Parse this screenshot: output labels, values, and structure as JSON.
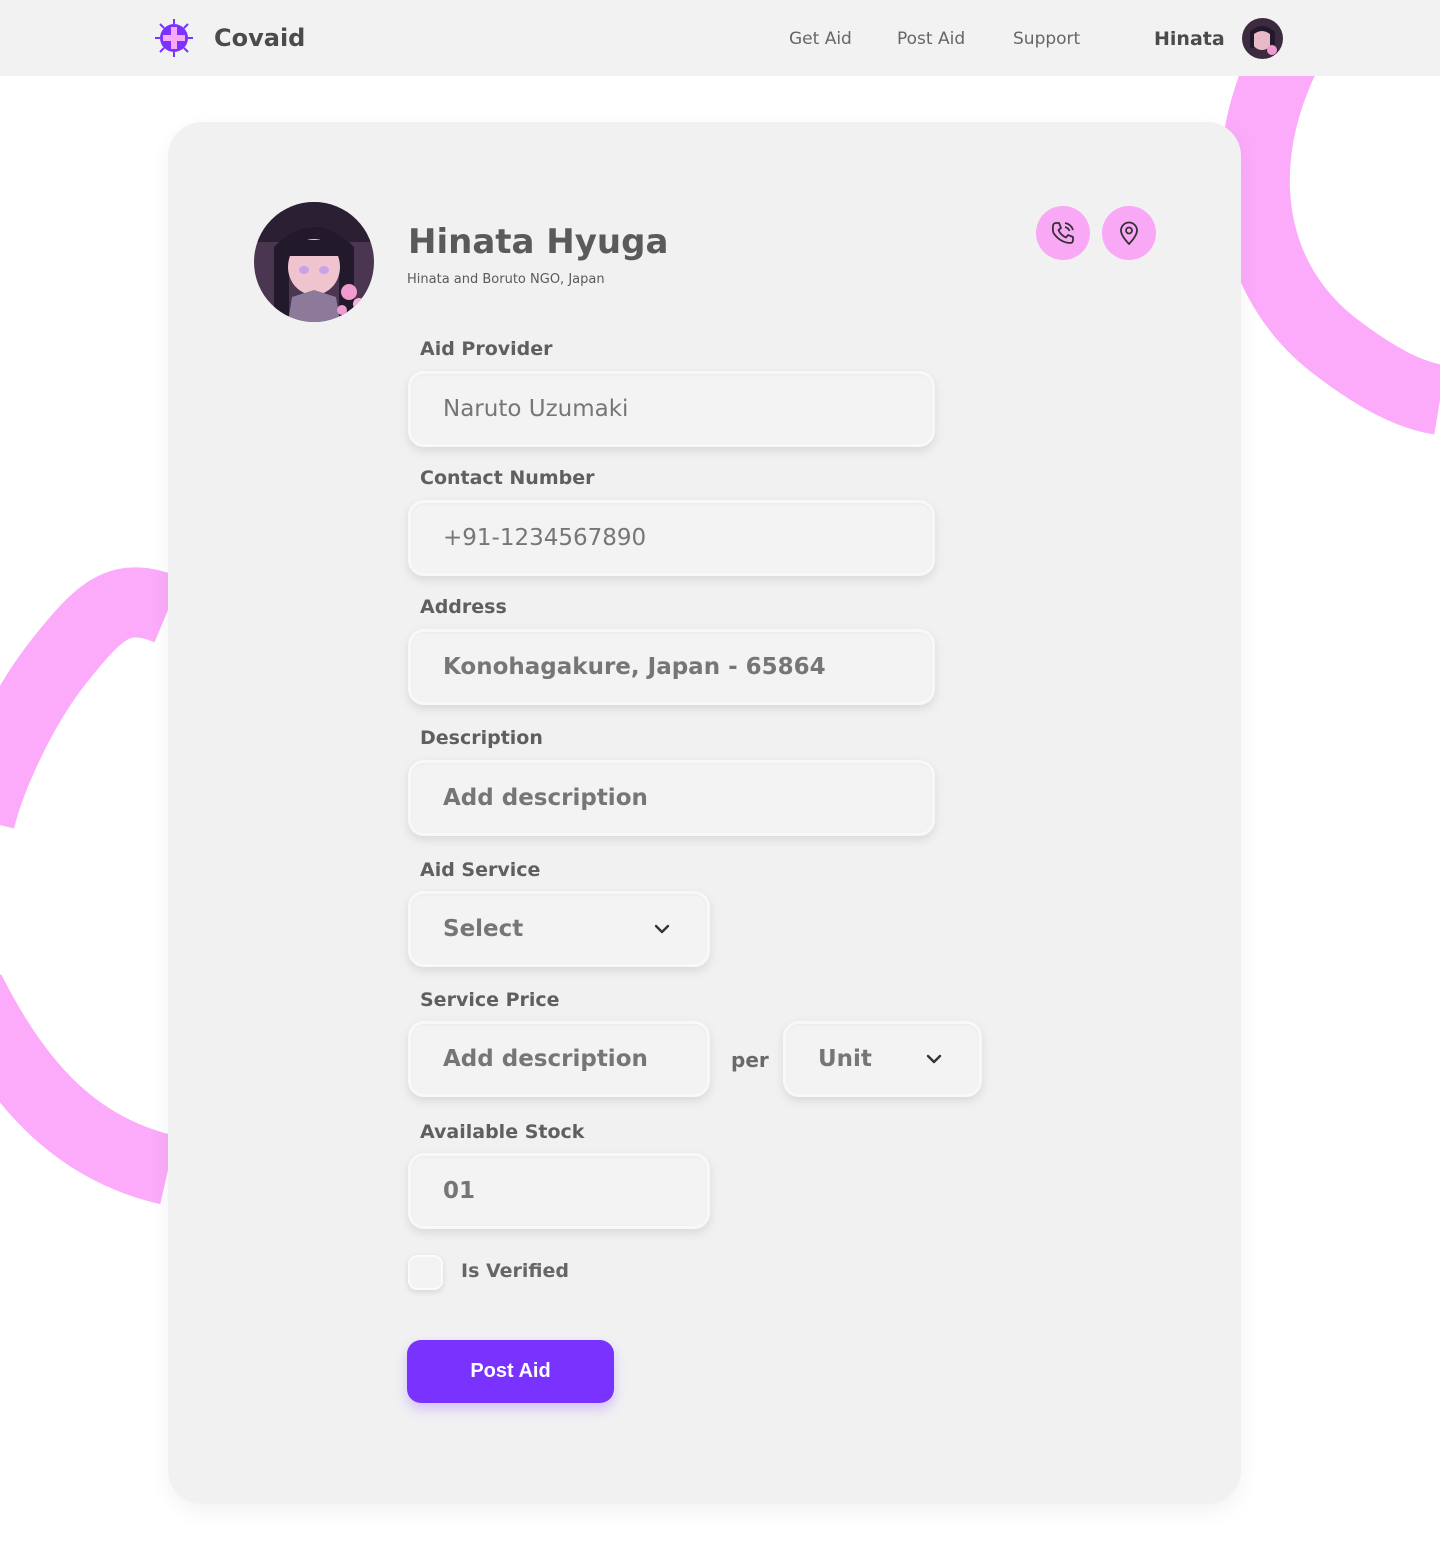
{
  "header": {
    "brand": "Covaid",
    "nav": [
      {
        "label": "Get Aid"
      },
      {
        "label": "Post Aid"
      },
      {
        "label": "Support"
      }
    ],
    "user_name": "Hinata"
  },
  "profile": {
    "name": "Hinata Hyuga",
    "organization": "Hinata and Boruto NGO, Japan",
    "actions": [
      "phone-icon",
      "location-pin-icon"
    ]
  },
  "form": {
    "aid_provider": {
      "label": "Aid Provider",
      "value": "Naruto Uzumaki"
    },
    "contact_number": {
      "label": "Contact Number",
      "value": "+91-1234567890"
    },
    "address": {
      "label": "Address",
      "value": "Konohagakure, Japan - 65864"
    },
    "description": {
      "label": "Description",
      "placeholder": "Add description"
    },
    "aid_service": {
      "label": "Aid Service",
      "selected": "Select"
    },
    "service_price": {
      "label": "Service Price",
      "placeholder": "Add description",
      "per_label": "per",
      "unit_selected": "Unit"
    },
    "available_stock": {
      "label": "Available Stock",
      "value": "01"
    },
    "is_verified": {
      "label": "Is Verified",
      "checked": false
    },
    "submit_label": "Post Aid"
  },
  "colors": {
    "accent_purple": "#7a32ff",
    "accent_pink": "#f9a8f6",
    "topbar_bg": "#f2f2f2",
    "card_bg": "#f1f1f2"
  }
}
